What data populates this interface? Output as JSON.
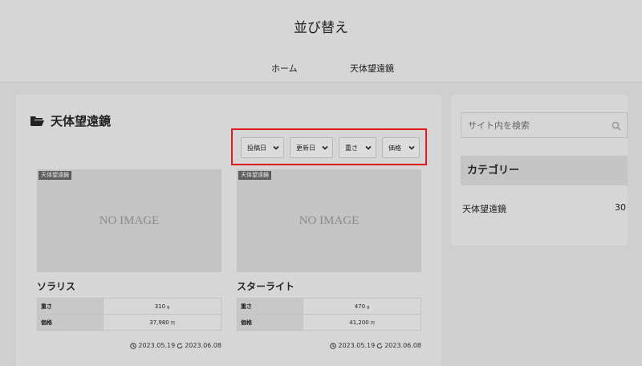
{
  "header": {
    "site_title": "並び替え"
  },
  "nav": {
    "items": [
      {
        "label": "ホーム"
      },
      {
        "label": "天体望遠鏡"
      }
    ]
  },
  "main": {
    "category_heading": "天体望遠鏡",
    "icons": {
      "heading": "folder-open-icon",
      "published": "clock-icon",
      "updated": "refresh-icon",
      "dropdown": "chevron-down-icon"
    },
    "sort_options": [
      {
        "label": "投稿日"
      },
      {
        "label": "更新日"
      },
      {
        "label": "重さ"
      },
      {
        "label": "価格"
      }
    ],
    "cards": [
      {
        "tag": "天体望遠鏡",
        "image_text": "NO IMAGE",
        "title": "ソラリス",
        "specs": [
          {
            "label": "重さ",
            "value": "310",
            "unit": "g"
          },
          {
            "label": "価格",
            "value": "37,980",
            "unit": "円"
          }
        ],
        "published": "2023.05.19",
        "updated": "2023.06.08"
      },
      {
        "tag": "天体望遠鏡",
        "image_text": "NO IMAGE",
        "title": "スターライト",
        "specs": [
          {
            "label": "重さ",
            "value": "470",
            "unit": "g"
          },
          {
            "label": "価格",
            "value": "41,200",
            "unit": "円"
          }
        ],
        "published": "2023.05.19",
        "updated": "2023.06.08"
      }
    ]
  },
  "sidebar": {
    "search_placeholder": "サイト内を検索",
    "search_icon": "search-icon",
    "category_heading": "カテゴリー",
    "categories": [
      {
        "name": "天体望遠鏡",
        "count": "30"
      }
    ]
  },
  "colors": {
    "highlight_border": "#e01b1b",
    "background": "#cfcfcf",
    "panel": "#d6d6d6"
  }
}
